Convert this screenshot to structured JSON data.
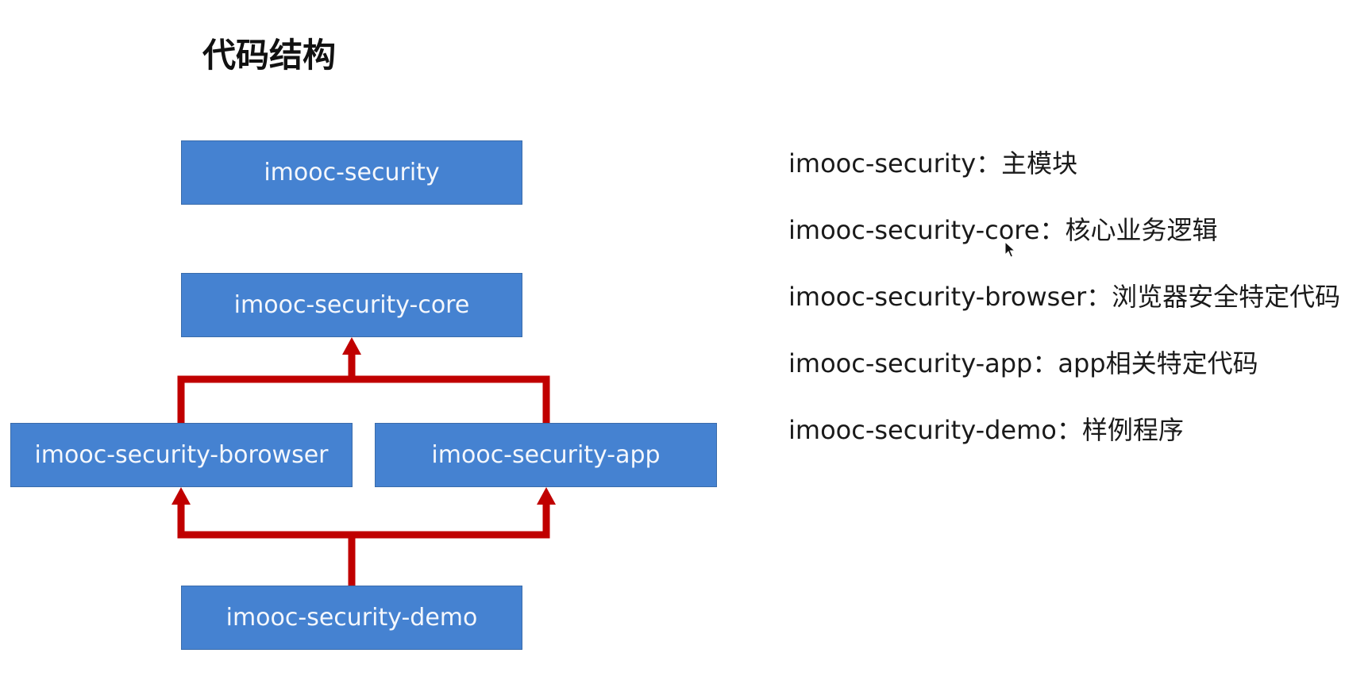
{
  "title": "代码结构",
  "diagram": {
    "modules": {
      "security": "imooc-security",
      "core": "imooc-security-core",
      "browser": "imooc-security-borowser",
      "app": "imooc-security-app",
      "demo": "imooc-security-demo"
    },
    "colors": {
      "box_fill": "#4582d1",
      "box_border": "#3a6cab",
      "box_text": "#f4f7fc",
      "connector": "#c00000"
    }
  },
  "descriptions": [
    {
      "module": "imooc-security",
      "separator": "：",
      "text": "主模块"
    },
    {
      "module": "imooc-security-core",
      "separator": "：",
      "text": "核心业务逻辑"
    },
    {
      "module": "imooc-security-browser",
      "separator": "：",
      "text": "浏览器安全特定代码"
    },
    {
      "module": "imooc-security-app",
      "separator": "：",
      "text": "app相关特定代码"
    },
    {
      "module": "imooc-security-demo",
      "separator": "：",
      "text": "样例程序"
    }
  ]
}
